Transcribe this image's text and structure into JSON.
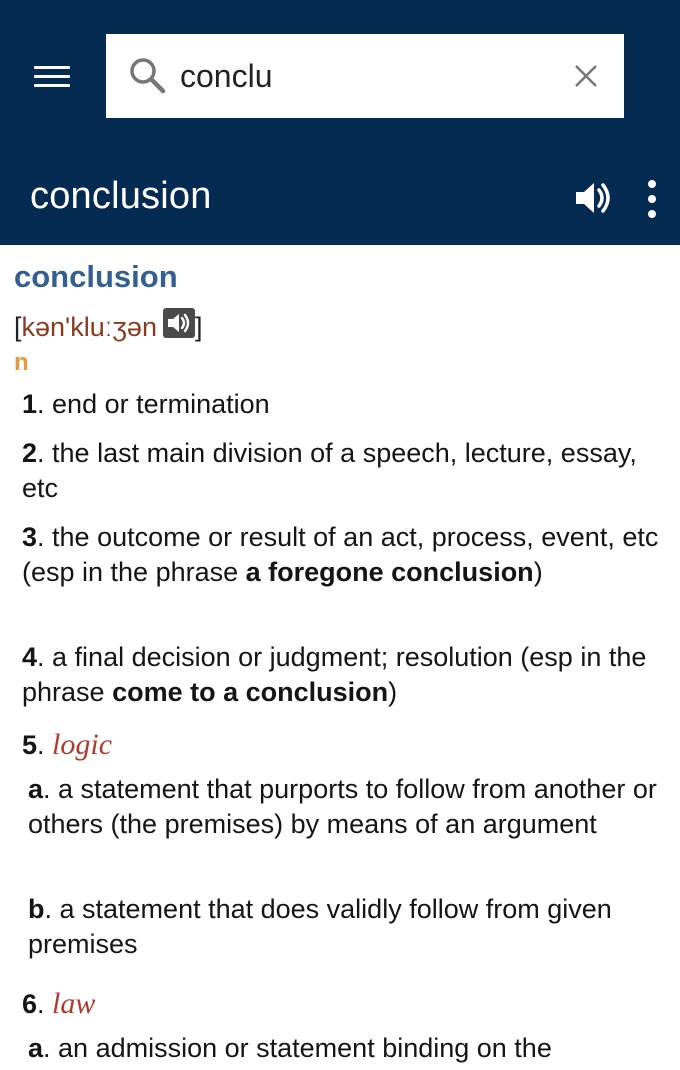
{
  "search": {
    "query": "conclu",
    "icons": {
      "search": "search-icon",
      "clear": "close-icon",
      "menu": "menu-icon"
    }
  },
  "header": {
    "headword": "conclusion",
    "icons": {
      "audio": "speaker-icon",
      "more": "more-vert-icon"
    }
  },
  "entry": {
    "word": "conclusion",
    "pron_open": "[",
    "pron_ipa": "kən'kluːʒən",
    "pron_close": "]",
    "pos": "n",
    "senses": [
      {
        "num": "1",
        "parts": [
          ". end or termination"
        ]
      },
      {
        "num": "2",
        "parts": [
          ". the last main division of a speech, lecture, essay, etc"
        ]
      },
      {
        "num": "3",
        "parts": [
          ". the outcome or result of an act, process, event, etc (esp in the phrase ",
          "a foregone conclusion",
          ")"
        ]
      },
      {
        "num": "4",
        "parts": [
          ". a final decision or judgment; resolution (esp in the phrase ",
          "come to a conclusion",
          ")"
        ]
      },
      {
        "num": "5",
        "field": "logic"
      },
      {
        "num": "6",
        "field": "law"
      }
    ],
    "subsenses": [
      {
        "letter": "a",
        "parts": [
          ". a statement that purports to follow from another or others (the ",
          "premises",
          ") by means of an argument"
        ]
      },
      {
        "letter": "b",
        "parts": [
          ". a statement that does validly follow from given premises"
        ]
      },
      {
        "letter": "a",
        "parts": [
          ". an admission or statement binding on the"
        ]
      }
    ]
  },
  "colors": {
    "appbar": "#062b52",
    "headword": "#335f91",
    "pos": "#e8973a",
    "field": "#b03a2e",
    "ipa": "#8a3a1f"
  }
}
